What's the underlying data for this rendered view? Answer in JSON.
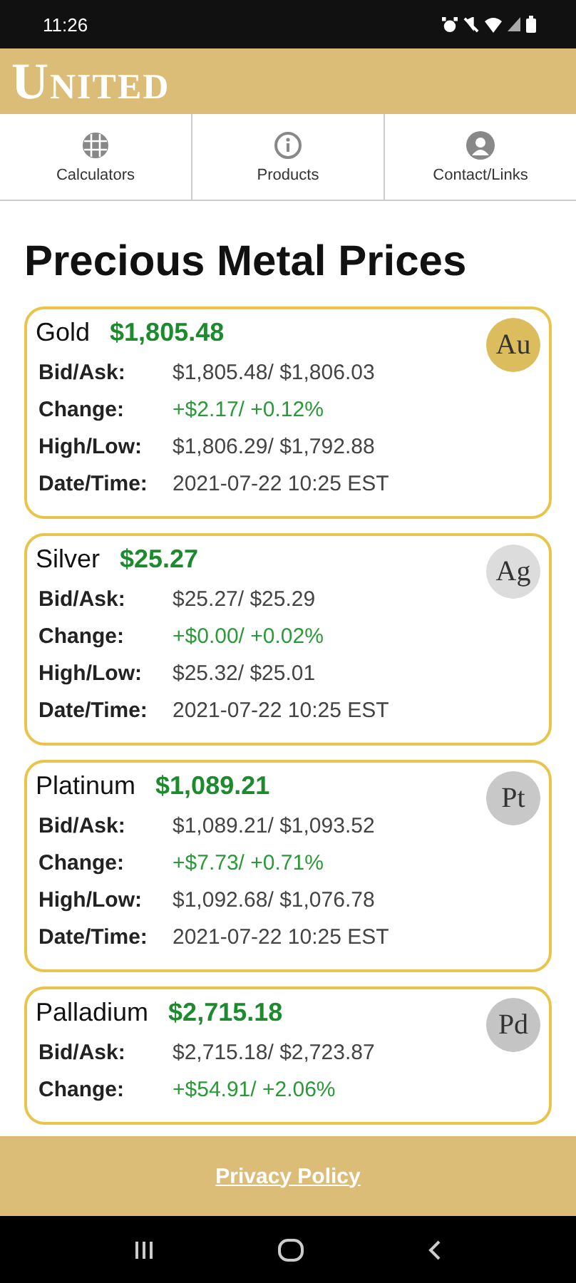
{
  "status_bar": {
    "time": "11:26"
  },
  "header": {
    "logo": "United"
  },
  "nav_tabs": [
    {
      "label": "Calculators",
      "kind": "grid"
    },
    {
      "label": "Products",
      "kind": "info"
    },
    {
      "label": "Contact/Links",
      "kind": "person"
    }
  ],
  "title": "Precious Metal Prices",
  "metals": [
    {
      "name": "Gold",
      "price": "$1,805.48",
      "symbol": "Au",
      "color": "#dcbd5e",
      "rows": [
        {
          "label": "Bid/Ask:",
          "value": "$1,805.48/ $1,806.03",
          "kind": "plain"
        },
        {
          "label": "Change:",
          "value": "+$2.17/ +0.12%",
          "kind": "change"
        },
        {
          "label": "High/Low:",
          "value": "$1,806.29/ $1,792.88",
          "kind": "plain"
        },
        {
          "label": "Date/Time:",
          "value": "2021-07-22 10:25 EST",
          "kind": "plain"
        }
      ]
    },
    {
      "name": "Silver",
      "price": "$25.27",
      "symbol": "Ag",
      "color": "#dcdcdc",
      "rows": [
        {
          "label": "Bid/Ask:",
          "value": "$25.27/ $25.29",
          "kind": "plain"
        },
        {
          "label": "Change:",
          "value": "+$0.00/ +0.02%",
          "kind": "change"
        },
        {
          "label": "High/Low:",
          "value": "$25.32/ $25.01",
          "kind": "plain"
        },
        {
          "label": "Date/Time:",
          "value": "2021-07-22 10:25 EST",
          "kind": "plain"
        }
      ]
    },
    {
      "name": "Platinum",
      "price": "$1,089.21",
      "symbol": "Pt",
      "color": "#c8c8c8",
      "rows": [
        {
          "label": "Bid/Ask:",
          "value": "$1,089.21/ $1,093.52",
          "kind": "plain"
        },
        {
          "label": "Change:",
          "value": "+$7.73/ +0.71%",
          "kind": "change"
        },
        {
          "label": "High/Low:",
          "value": "$1,092.68/ $1,076.78",
          "kind": "plain"
        },
        {
          "label": "Date/Time:",
          "value": "2021-07-22 10:25 EST",
          "kind": "plain"
        }
      ]
    },
    {
      "name": "Palladium",
      "price": "$2,715.18",
      "symbol": "Pd",
      "color": "#c4c4c4",
      "rows": [
        {
          "label": "Bid/Ask:",
          "value": "$2,715.18/ $2,723.87",
          "kind": "plain"
        },
        {
          "label": "Change:",
          "value": "+$54.91/ +2.06%",
          "kind": "change"
        }
      ]
    }
  ],
  "footer": {
    "link": "Privacy Policy"
  }
}
